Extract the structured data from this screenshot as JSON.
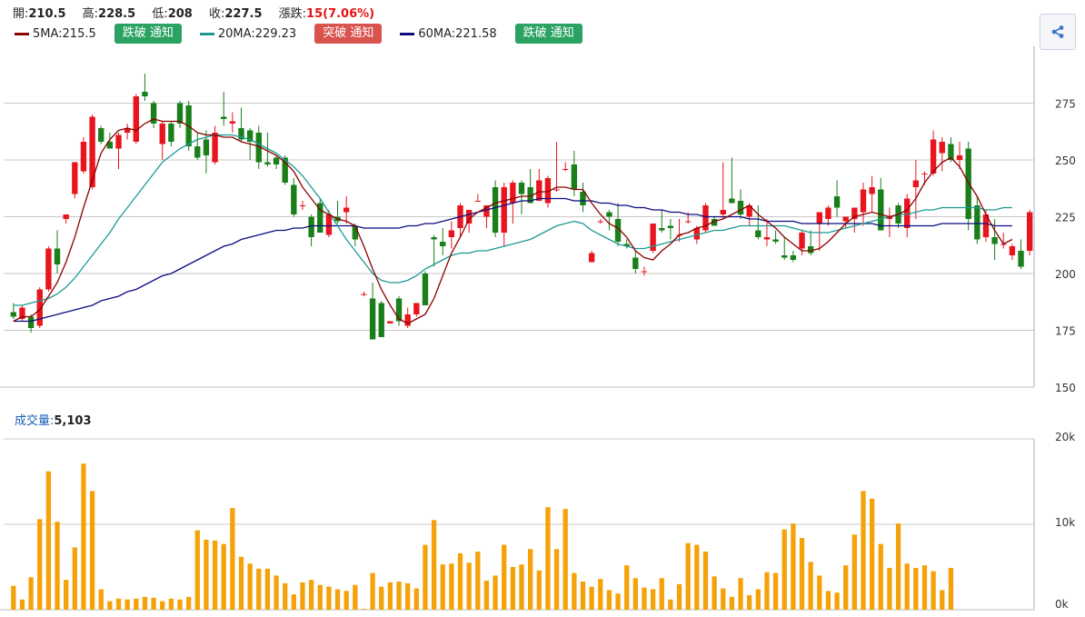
{
  "ohlc": {
    "open_label": "開:",
    "open": "210.5",
    "high_label": "高:",
    "high": "228.5",
    "low_label": "低:",
    "low": "208",
    "close_label": "收:",
    "close": "227.5",
    "change_label": "漲跌:",
    "change": "15(7.06%)"
  },
  "legend": [
    {
      "name": "5MA:215.5",
      "color": "#8b0000",
      "button": "跌破 通知",
      "button_color": "green"
    },
    {
      "name": "20MA:229.23",
      "color": "#1a9a94",
      "button": "突破 通知",
      "button_color": "red"
    },
    {
      "name": "60MA:221.58",
      "color": "#0b0b80",
      "button": "跌破 通知",
      "button_color": "green"
    }
  ],
  "volume": {
    "label": "成交量:",
    "value": "5,103"
  },
  "colors": {
    "up": "#e8141e",
    "down": "#1a7f1a",
    "volume": "#f5a20a",
    "grid": "#c8c8c8",
    "ma5": "#8b0000",
    "ma20": "#1a9a94",
    "ma60": "#0b0b80"
  },
  "icons": {
    "share": "share-icon"
  },
  "chart_data": [
    {
      "type": "candlestick",
      "title": "",
      "y_ticks": [
        275,
        250,
        225,
        200,
        175,
        150
      ],
      "ylim": [
        150,
        300
      ],
      "grid": true,
      "candles": [
        [
          183,
          187,
          180,
          181
        ],
        [
          180,
          186,
          179,
          185
        ],
        [
          181,
          182,
          174,
          176
        ],
        [
          177,
          194,
          176,
          193
        ],
        [
          193,
          212,
          192,
          211
        ],
        [
          211,
          219,
          200,
          204
        ],
        [
          224,
          226,
          222,
          226
        ],
        [
          235,
          249,
          233,
          249
        ],
        [
          245,
          260,
          244,
          258
        ],
        [
          238,
          270,
          237,
          269
        ],
        [
          264,
          265,
          257,
          258
        ],
        [
          258,
          262,
          255,
          255
        ],
        [
          255,
          262,
          246,
          261
        ],
        [
          262,
          266,
          259,
          264
        ],
        [
          258,
          279,
          257,
          278
        ],
        [
          280,
          288,
          276,
          278
        ],
        [
          275,
          276,
          264,
          266
        ],
        [
          257,
          267,
          250,
          266
        ],
        [
          266,
          267,
          256,
          258
        ],
        [
          275,
          276,
          264,
          266
        ],
        [
          274,
          276,
          254,
          256
        ],
        [
          256,
          262,
          250,
          251
        ],
        [
          259,
          263,
          244,
          252
        ],
        [
          249,
          265,
          248,
          262
        ],
        [
          269,
          280,
          265,
          268
        ],
        [
          266,
          271,
          262,
          267
        ],
        [
          264,
          273,
          258,
          259
        ],
        [
          263,
          264,
          250,
          258
        ],
        [
          262,
          265,
          246,
          249
        ],
        [
          249,
          262,
          247,
          248
        ],
        [
          251,
          252,
          246,
          248
        ],
        [
          251,
          252,
          239,
          240
        ],
        [
          239,
          242,
          225,
          226
        ],
        [
          230,
          232,
          228,
          230
        ],
        [
          225,
          226,
          212,
          216
        ],
        [
          231,
          233,
          218,
          218
        ],
        [
          217,
          228,
          216,
          226
        ],
        [
          225,
          232,
          222,
          223
        ],
        [
          227,
          234,
          222,
          229
        ],
        [
          221,
          222,
          212,
          215
        ],
        [
          191,
          192,
          190,
          191
        ],
        [
          189,
          196,
          172,
          171
        ],
        [
          187,
          188,
          172,
          172
        ],
        [
          178,
          179,
          178,
          179
        ],
        [
          189,
          190,
          177,
          179
        ],
        [
          177,
          185,
          176,
          182
        ],
        [
          182,
          187,
          181,
          187
        ],
        [
          200,
          201,
          186,
          186
        ],
        [
          216,
          217,
          203,
          215
        ],
        [
          214,
          220,
          208,
          212
        ],
        [
          216,
          223,
          211,
          219
        ],
        [
          220,
          231,
          216,
          230
        ],
        [
          222,
          228,
          218,
          228
        ],
        [
          232,
          235,
          232,
          232
        ],
        [
          225,
          229,
          220,
          230
        ],
        [
          238,
          241,
          216,
          218
        ],
        [
          218,
          240,
          212,
          238
        ],
        [
          231,
          241,
          222,
          240
        ],
        [
          240,
          241,
          226,
          235
        ],
        [
          238,
          246,
          231,
          231
        ],
        [
          232,
          246,
          232,
          241
        ],
        [
          231,
          243,
          229,
          242
        ],
        [
          237,
          258,
          236,
          237
        ],
        [
          246,
          249,
          245,
          246
        ],
        [
          248,
          254,
          234,
          237
        ],
        [
          236,
          240,
          227,
          230
        ],
        [
          205,
          210,
          206,
          209
        ],
        [
          223,
          224,
          222,
          223
        ],
        [
          227,
          228,
          219,
          225
        ],
        [
          224,
          231,
          212,
          214
        ],
        [
          213,
          215,
          211,
          212
        ],
        [
          207,
          210,
          200,
          202
        ],
        [
          201,
          203,
          199,
          201
        ],
        [
          210,
          222,
          209,
          222
        ],
        [
          220,
          228,
          218,
          219
        ],
        [
          221,
          224,
          215,
          220
        ],
        [
          217,
          224,
          214,
          217
        ],
        [
          223,
          227,
          222,
          223
        ],
        [
          215,
          221,
          213,
          220
        ],
        [
          219,
          231,
          218,
          230
        ],
        [
          224,
          225,
          221,
          221
        ],
        [
          226,
          249,
          224,
          228
        ],
        [
          233,
          251,
          232,
          231
        ],
        [
          232,
          237,
          224,
          226
        ],
        [
          225,
          231,
          221,
          230
        ],
        [
          219,
          230,
          215,
          216
        ],
        [
          215,
          224,
          212,
          216
        ],
        [
          215,
          219,
          213,
          214
        ],
        [
          208,
          216,
          206,
          207
        ],
        [
          208,
          210,
          205,
          206
        ],
        [
          211,
          219,
          208,
          218
        ],
        [
          212,
          219,
          208,
          209
        ],
        [
          222,
          227,
          210,
          227
        ],
        [
          224,
          230,
          221,
          229
        ],
        [
          234,
          241,
          225,
          229
        ],
        [
          223,
          225,
          220,
          225
        ],
        [
          224,
          227,
          218,
          229
        ],
        [
          227,
          240,
          221,
          237
        ],
        [
          235,
          243,
          227,
          238
        ],
        [
          237,
          242,
          219,
          219
        ],
        [
          224,
          229,
          216,
          225
        ],
        [
          230,
          231,
          220,
          222
        ],
        [
          220,
          235,
          216,
          233
        ],
        [
          238,
          250,
          224,
          241
        ],
        [
          244,
          245,
          239,
          244
        ],
        [
          244,
          263,
          243,
          259
        ],
        [
          253,
          260,
          245,
          258
        ],
        [
          257,
          260,
          249,
          250
        ],
        [
          250,
          258,
          246,
          252
        ],
        [
          255,
          258,
          219,
          224
        ],
        [
          230,
          234,
          213,
          215
        ],
        [
          216,
          228,
          214,
          226
        ],
        [
          216,
          224,
          206,
          213
        ],
        [
          213,
          218,
          211,
          213
        ],
        [
          208,
          213,
          206,
          212
        ],
        [
          210,
          215,
          202,
          203
        ],
        [
          210,
          228,
          208,
          227
        ]
      ],
      "ma5": [
        179,
        181,
        181,
        184,
        190,
        196,
        205,
        216,
        229,
        241,
        253,
        259,
        263,
        264,
        263,
        266,
        268,
        267,
        267,
        267,
        265,
        262,
        261,
        261,
        260,
        260,
        258,
        257,
        256,
        254,
        252,
        249,
        245,
        238,
        233,
        228,
        226,
        224,
        223,
        221,
        212,
        202,
        193,
        186,
        180,
        178,
        180,
        182,
        189,
        199,
        209,
        216,
        224,
        227,
        229,
        231,
        232,
        233,
        234,
        234,
        236,
        236,
        238,
        238,
        237,
        237,
        231,
        226,
        222,
        220,
        216,
        210,
        207,
        206,
        210,
        213,
        217,
        218,
        220,
        221,
        223,
        224,
        226,
        228,
        230,
        226,
        223,
        220,
        216,
        213,
        210,
        210,
        211,
        214,
        218,
        222,
        225,
        226,
        227,
        226,
        225,
        226,
        228,
        233,
        240,
        245,
        249,
        251,
        247,
        240,
        234,
        226,
        219,
        213,
        215
      ],
      "ma20": [
        186,
        186,
        187,
        188,
        189,
        191,
        194,
        198,
        203,
        208,
        213,
        218,
        224,
        229,
        234,
        239,
        244,
        249,
        252,
        255,
        257,
        259,
        260,
        261,
        261,
        261,
        260,
        259,
        257,
        255,
        253,
        250,
        247,
        243,
        238,
        233,
        227,
        221,
        215,
        210,
        205,
        200,
        197,
        196,
        196,
        197,
        199,
        202,
        204,
        206,
        208,
        209,
        209,
        210,
        210,
        211,
        212,
        213,
        214,
        215,
        217,
        219,
        221,
        222,
        223,
        222,
        219,
        217,
        215,
        213,
        212,
        211,
        211,
        212,
        213,
        214,
        215,
        216,
        217,
        218,
        219,
        219,
        220,
        221,
        221,
        221,
        221,
        221,
        221,
        220,
        219,
        218,
        218,
        218,
        219,
        220,
        221,
        222,
        223,
        224,
        225,
        226,
        226,
        227,
        228,
        228,
        229,
        229,
        229,
        229,
        229,
        228,
        228,
        229,
        229
      ],
      "ma60": [
        179,
        179,
        179,
        180,
        181,
        182,
        183,
        184,
        185,
        186,
        188,
        189,
        190,
        192,
        193,
        195,
        197,
        199,
        200,
        202,
        204,
        206,
        208,
        210,
        212,
        213,
        215,
        216,
        217,
        218,
        219,
        219,
        220,
        220,
        221,
        221,
        221,
        221,
        221,
        221,
        220,
        220,
        220,
        220,
        220,
        221,
        221,
        222,
        222,
        223,
        224,
        225,
        226,
        227,
        228,
        229,
        230,
        231,
        232,
        232,
        233,
        233,
        233,
        233,
        232,
        232,
        232,
        231,
        231,
        230,
        230,
        229,
        229,
        228,
        228,
        227,
        227,
        226,
        226,
        225,
        225,
        225,
        225,
        225,
        224,
        224,
        223,
        223,
        223,
        223,
        222,
        222,
        222,
        222,
        222,
        222,
        222,
        222,
        222,
        221,
        221,
        221,
        221,
        221,
        221,
        221,
        222,
        222,
        222,
        222,
        222,
        222,
        221,
        221,
        221
      ]
    },
    {
      "type": "bar",
      "title": "",
      "y_ticks": [
        "20k",
        "10k",
        "0k"
      ],
      "ylim": [
        0,
        20000
      ],
      "values": [
        2800,
        1200,
        3800,
        10600,
        16200,
        10300,
        3500,
        7300,
        17100,
        13900,
        2400,
        1000,
        1300,
        1200,
        1300,
        1500,
        1400,
        1000,
        1300,
        1200,
        1500,
        9300,
        8200,
        8100,
        7700,
        11900,
        6200,
        5400,
        4800,
        4800,
        4000,
        3100,
        1800,
        3200,
        3500,
        2900,
        2700,
        2400,
        2200,
        2900,
        100,
        4300,
        2700,
        3200,
        3300,
        3100,
        2500,
        7600,
        10500,
        5300,
        5400,
        6600,
        5500,
        6800,
        3400,
        4000,
        7600,
        5000,
        5300,
        7100,
        4600,
        12000,
        7100,
        11800,
        4300,
        3300,
        2700,
        3600,
        2300,
        1900,
        5200,
        3700,
        2600,
        2400,
        3700,
        1200,
        3000,
        7800,
        7600,
        6800,
        3900,
        2500,
        1500,
        3700,
        1700,
        2400,
        4400,
        4300,
        9400,
        10100,
        8400,
        5600,
        4000,
        2200,
        2000,
        5200,
        8800,
        13900,
        13000,
        7700,
        4900,
        10100,
        5400,
        4900,
        5200,
        4500,
        2300,
        4900
      ]
    }
  ]
}
